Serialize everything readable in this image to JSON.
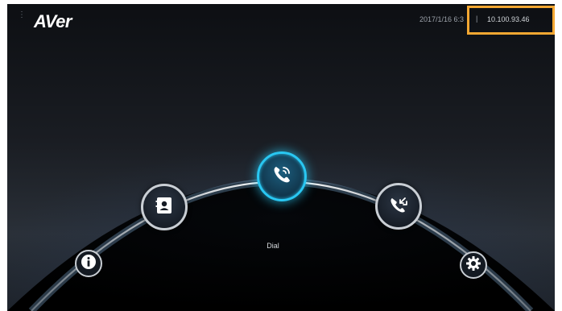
{
  "brand": {
    "logo_text": "AVer"
  },
  "status": {
    "datetime": "2017/1/16 6:3",
    "separator": "|",
    "ip_address": "10.100.93.46"
  },
  "home": {
    "dial_label": "Dial",
    "selected": "Dial"
  },
  "icons": {
    "contacts": "contacts-book-icon",
    "dial": "phone-call-icon",
    "call_log": "call-history-icon",
    "info": "info-icon",
    "settings": "gear-icon"
  },
  "colors": {
    "accent": "#29c7f2",
    "highlight_box": "#f3a732",
    "ring": "#c9ced4"
  }
}
